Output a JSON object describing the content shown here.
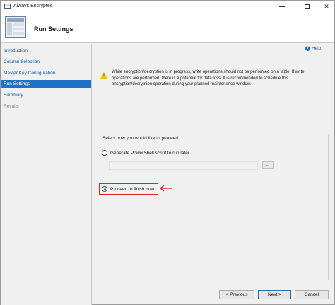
{
  "window": {
    "title": "Always Encrypted"
  },
  "header": {
    "title": "Run Settings"
  },
  "sidebar": {
    "items": [
      {
        "label": "Introduction",
        "state": "link"
      },
      {
        "label": "Column Selection",
        "state": "link"
      },
      {
        "label": "Master Key Configuration",
        "state": "link"
      },
      {
        "label": "Run Settings",
        "state": "active"
      },
      {
        "label": "Summary",
        "state": "link"
      },
      {
        "label": "Results",
        "state": "disabled"
      }
    ]
  },
  "help": {
    "label": "Help"
  },
  "warning": {
    "text": "While encryption/decryption is in progress, write operations should not be performed on a table. If write operations are performed, there is a potential for data loss. It is recommended to schedule this encryption/decryption operation during your planned maintenance window."
  },
  "options": {
    "group_title": "Select how you would like to proceed",
    "powershell_label": "Generate PowerShell script to run later",
    "powershell_selected": false,
    "script_path_value": "",
    "browse_label": "...",
    "finish_label": "Proceed to finish now",
    "finish_selected": true
  },
  "footer": {
    "previous_label": "< Previous",
    "next_label": "Next >",
    "cancel_label": "Cancel"
  },
  "colors": {
    "accent": "#1e73c8",
    "highlight": "#d8262b",
    "warning": "#f2c21b"
  }
}
